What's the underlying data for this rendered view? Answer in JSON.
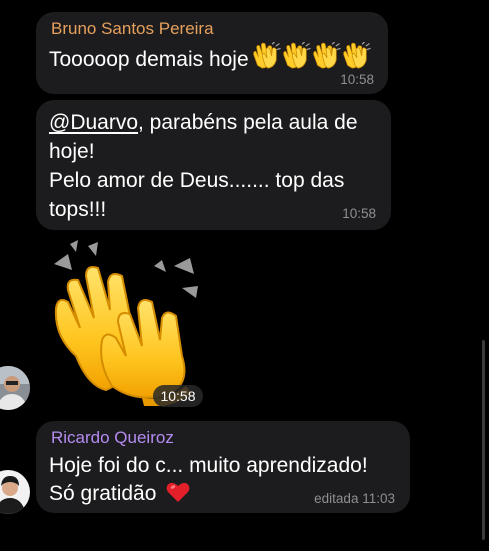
{
  "messages": [
    {
      "sender": "Bruno Santos Pereira",
      "sender_color": "#e6a05c",
      "text": "Tooooop demais hoje",
      "trailing_emoji_icon": "clapping-hands-icon",
      "trailing_emoji_count": 4,
      "time": "10:58"
    },
    {
      "mention": "@Duarvo",
      "line1_rest": ", parabéns pela aula de",
      "line2": "hoje!",
      "line3": "Pelo amor de Deus....... top das",
      "line4": "tops!!!",
      "time": "10:58"
    },
    {
      "type": "sticker",
      "icon": "clapping-hands-icon",
      "time": "10:58"
    },
    {
      "sender": "Ricardo Queiroz",
      "sender_color": "#b48cf0",
      "line1": "Hoje foi do c... muito aprendizado!",
      "line2": "Só gratidão",
      "trailing_emoji_icon": "red-heart-icon",
      "edited_label": "editada",
      "time": "11:03"
    }
  ],
  "colors": {
    "background": "#000000",
    "bubble": "#1c1c1e",
    "timestamp": "#8e8e93"
  }
}
